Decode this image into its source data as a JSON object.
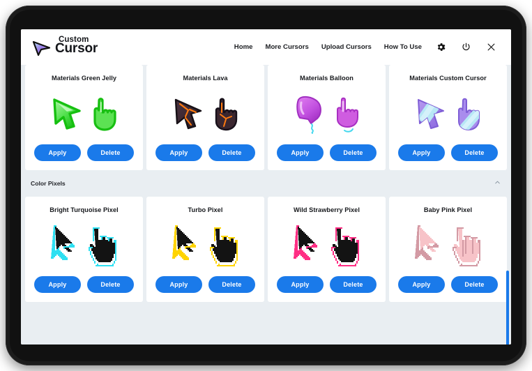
{
  "app": {
    "logo_top": "Custom",
    "logo_bottom": "Cursor",
    "accent_color": "#1a7aea",
    "background_color": "#e9eef2"
  },
  "nav": {
    "links": [
      {
        "label": "Home"
      },
      {
        "label": "More Cursors"
      },
      {
        "label": "Upload Cursors"
      },
      {
        "label": "How To Use"
      }
    ],
    "icons": [
      {
        "name": "gear-icon"
      },
      {
        "name": "power-icon"
      },
      {
        "name": "close-icon"
      }
    ]
  },
  "sections": [
    {
      "title": null,
      "cards": [
        {
          "title": "Materials Green Jelly",
          "apply": "Apply",
          "delete": "Delete",
          "style": "jelly-green"
        },
        {
          "title": "Materials Lava",
          "apply": "Apply",
          "delete": "Delete",
          "style": "lava"
        },
        {
          "title": "Materials Balloon",
          "apply": "Apply",
          "delete": "Delete",
          "style": "balloon"
        },
        {
          "title": "Materials Custom Cursor",
          "apply": "Apply",
          "delete": "Delete",
          "style": "custom"
        }
      ]
    },
    {
      "title": "Color Pixels",
      "collapse_icon": "chevron-up-icon",
      "cards": [
        {
          "title": "Bright Turquoise Pixel",
          "apply": "Apply",
          "delete": "Delete",
          "style": "pixel-cyan",
          "outline": "#2ee0f2",
          "fill": "#131313"
        },
        {
          "title": "Turbo Pixel",
          "apply": "Apply",
          "delete": "Delete",
          "style": "pixel-yellow",
          "outline": "#ffd400",
          "fill": "#131313"
        },
        {
          "title": "Wild Strawberry Pixel",
          "apply": "Apply",
          "delete": "Delete",
          "style": "pixel-pink",
          "outline": "#ff2e84",
          "fill": "#131313"
        },
        {
          "title": "Baby Pink Pixel",
          "apply": "Apply",
          "delete": "Delete",
          "style": "pixel-baby",
          "outline": "#d39aa4",
          "fill": "#f7c3c8"
        }
      ]
    }
  ]
}
